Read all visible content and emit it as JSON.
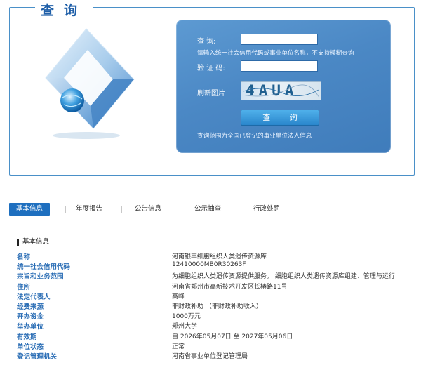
{
  "search": {
    "legend": "查询",
    "keyword_label": "查    询:",
    "keyword_value": "",
    "hint": "请输入统一社会信用代码或事业单位名称，不支持模糊查询",
    "captcha_label": "验 证 码:",
    "captcha_value": "",
    "refresh_label": "刷新图片",
    "captcha_text": "4AUA",
    "submit_label": "查  询",
    "scope_note": "查询范围为全国已登记的事业单位法人信息"
  },
  "tabs": [
    {
      "label": "基本信息",
      "active": true
    },
    {
      "label": "年度报告",
      "active": false
    },
    {
      "label": "公告信息",
      "active": false
    },
    {
      "label": "公示抽查",
      "active": false
    },
    {
      "label": "行政处罚",
      "active": false
    }
  ],
  "basic_info": {
    "title": "基本信息",
    "rows": [
      {
        "key": "名称",
        "value": "河南银丰细胞组织人类遗传资源库"
      },
      {
        "key": "统一社会信用代码",
        "value": "12410000MB0R30263F"
      },
      {
        "key": "宗旨和业务范围",
        "value": "为细胞组织人类遗传资源提供服务。  细胞组织人类遗传资源库组建、管理与运行"
      },
      {
        "key": "住所",
        "value": "河南省郑州市高新技术开发区长椿路11号"
      },
      {
        "key": "法定代表人",
        "value": "高峰"
      },
      {
        "key": "经费来源",
        "value": "非财政补助 （非财政补助收入）"
      },
      {
        "key": "开办资金",
        "value": "1000万元"
      },
      {
        "key": "举办单位",
        "value": "郑州大学"
      },
      {
        "key": "有效期",
        "value": "自 2026年05月07日 至 2027年05月06日"
      },
      {
        "key": "单位状态",
        "value": "正常"
      },
      {
        "key": "登记管理机关",
        "value": "河南省事业单位登记管理局"
      }
    ]
  },
  "colors": {
    "brand_blue": "#1e6fbf",
    "panel_blue": "#4b88c5",
    "key_blue": "#2a6db5"
  }
}
